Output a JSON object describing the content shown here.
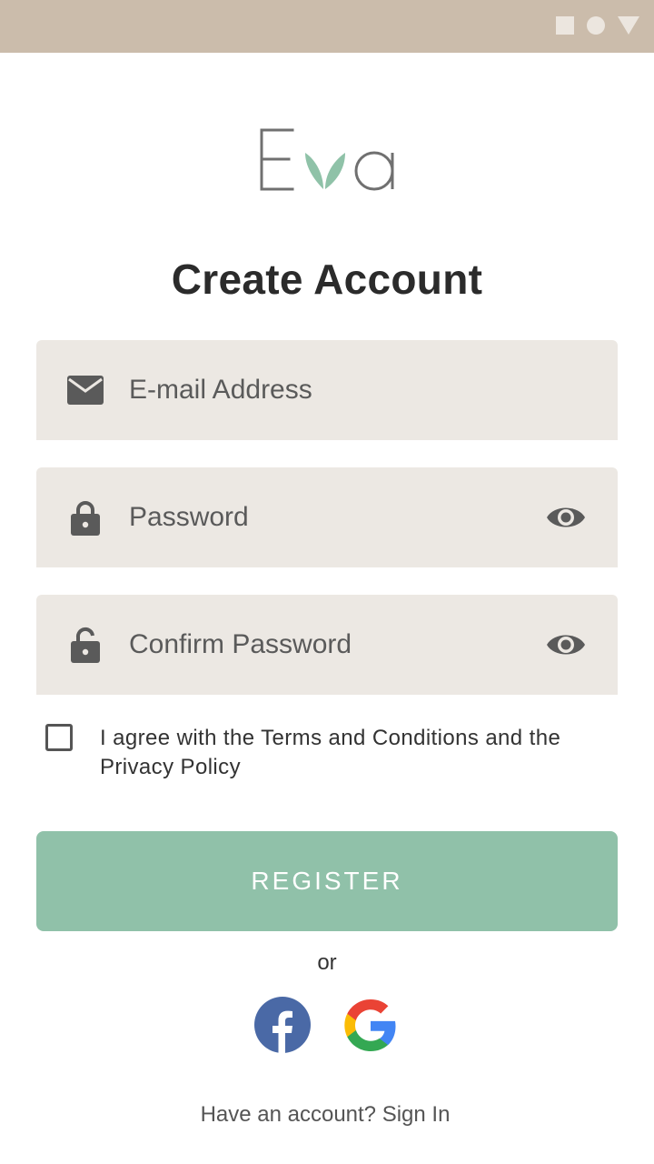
{
  "status_bar": {
    "color": "#cbbcab",
    "icons": [
      "square-icon",
      "circle-icon",
      "triangle-icon"
    ]
  },
  "logo": {
    "text": "Eva",
    "leaf_color": "#8fc2a8"
  },
  "title": "Create Account",
  "fields": {
    "email": {
      "placeholder": "E-mail Address",
      "value": "",
      "icon": "mail-icon"
    },
    "password": {
      "placeholder": "Password",
      "value": "",
      "icon": "lock-icon",
      "toggle_icon": "eye-icon"
    },
    "confirm": {
      "placeholder": "Confirm Password",
      "value": "",
      "icon": "lock-icon",
      "toggle_icon": "eye-icon"
    }
  },
  "terms": {
    "checked": false,
    "label": "I agree with the Terms and Conditions and the Privacy Policy"
  },
  "register_label": "REGISTER",
  "or_label": "or",
  "social": [
    "facebook-icon",
    "google-icon"
  ],
  "signin_label": "Have an account? Sign In",
  "colors": {
    "accent": "#90c1a9",
    "field_bg": "#ece8e3",
    "icon": "#5a5a5a"
  }
}
